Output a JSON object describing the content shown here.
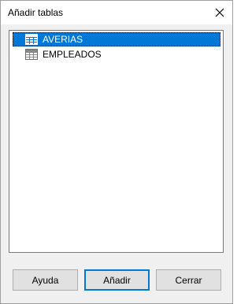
{
  "dialog": {
    "title": "Añadir tablas",
    "close_icon": "close-icon"
  },
  "tables": [
    {
      "name": "AVERIAS",
      "icon": "table-icon",
      "selected": true
    },
    {
      "name": "EMPLEADOS",
      "icon": "table-icon",
      "selected": false
    }
  ],
  "buttons": {
    "help_label": "Ayuda",
    "add_label": "Añadir",
    "close_label": "Cerrar"
  },
  "colors": {
    "selection": "#0078d7",
    "default_button_border": "#0078d7"
  }
}
